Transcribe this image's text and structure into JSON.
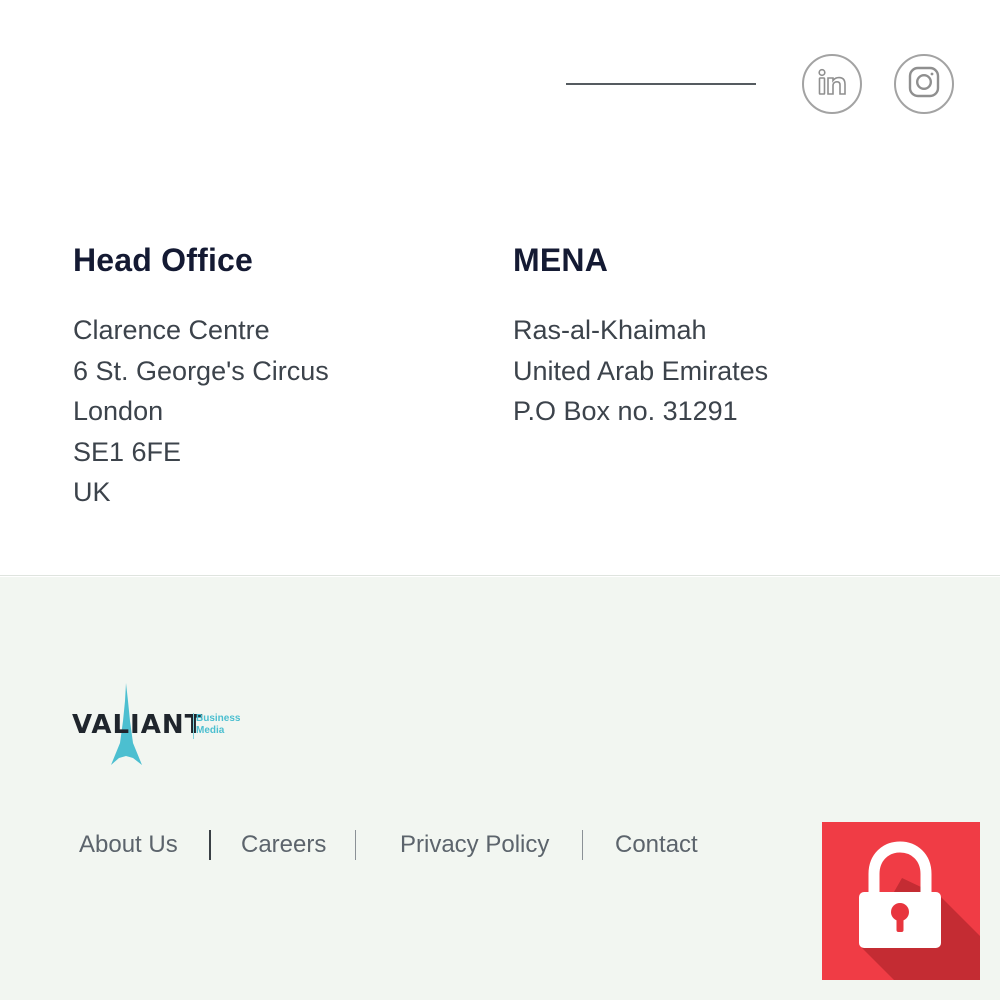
{
  "social": {
    "linkedin_icon": "linkedin-icon",
    "instagram_icon": "instagram-icon"
  },
  "offices": [
    {
      "title": "Head Office",
      "lines": [
        "Clarence Centre",
        "6 St. George's Circus",
        "London",
        "SE1 6FE",
        "UK"
      ]
    },
    {
      "title": "MENA",
      "lines": [
        "Ras-al-Khaimah",
        "United Arab Emirates",
        "P.O Box no. 31291"
      ]
    }
  ],
  "logo": {
    "word": "VALIANT",
    "sub_line1": "Business",
    "sub_line2": "Media"
  },
  "footer_nav": [
    "About Us",
    "Careers",
    "Privacy Policy",
    "Contact"
  ],
  "lock_icon": "padlock-icon",
  "colors": {
    "heading": "#141a33",
    "body_text": "#3c434b",
    "footer_bg": "#f2f6f1",
    "logo_accent": "#4cbfd0",
    "lock_badge": "#f03c45"
  }
}
